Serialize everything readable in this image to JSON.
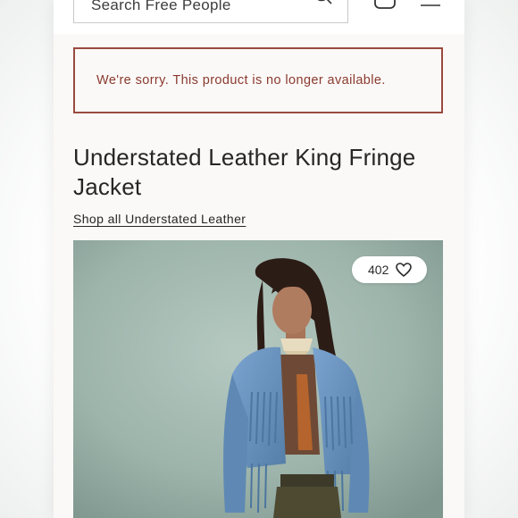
{
  "header": {
    "search_placeholder": "Search Free People",
    "icons": [
      "search-icon",
      "bag-icon",
      "menu-icon"
    ]
  },
  "alert": {
    "message": "We're sorry. This product is no longer available.",
    "color": "#8a3a2f"
  },
  "product": {
    "title": "Understated Leather King Fringe Jacket",
    "shop_link": "Shop all Understated Leather",
    "likes": "402",
    "like_icon": "heart-outline-icon"
  },
  "colors": {
    "page_background": "#fbf9f7",
    "alert_border": "#9a4a3f",
    "photo_backdrop": "#9fb6ae",
    "jacket": "#6b93bf"
  }
}
